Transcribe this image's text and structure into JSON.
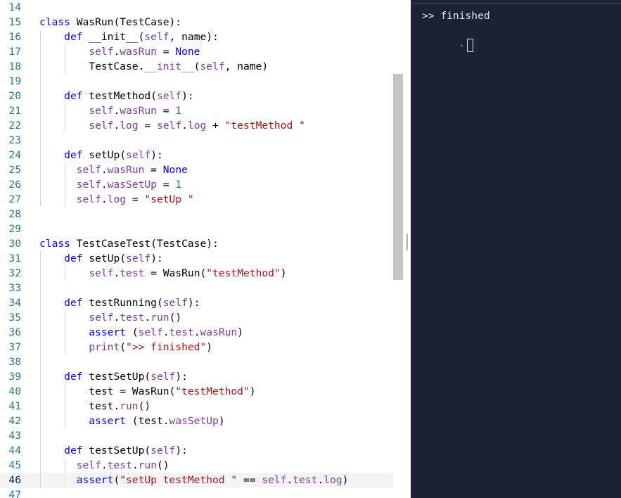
{
  "editor": {
    "current_line": 46,
    "lines": [
      {
        "no": "14",
        "segs": []
      },
      {
        "no": "15",
        "segs": [
          [
            "k",
            "class"
          ],
          [
            "p",
            " WasRun(TestCase):"
          ]
        ]
      },
      {
        "no": "16",
        "segs": [
          [
            "p",
            "    "
          ],
          [
            "k",
            "def"
          ],
          [
            "p",
            " __init__("
          ],
          [
            "sf",
            "self"
          ],
          [
            "p",
            ", name):"
          ]
        ]
      },
      {
        "no": "17",
        "segs": [
          [
            "p",
            "        "
          ],
          [
            "sf",
            "self"
          ],
          [
            "p",
            "."
          ],
          [
            "sf",
            "wasRun"
          ],
          [
            "p",
            " = "
          ],
          [
            "k",
            "None"
          ]
        ]
      },
      {
        "no": "18",
        "segs": [
          [
            "p",
            "        TestCase."
          ],
          [
            "sf",
            "__init__"
          ],
          [
            "p",
            "("
          ],
          [
            "sf",
            "self"
          ],
          [
            "p",
            ", name)"
          ]
        ]
      },
      {
        "no": "19",
        "segs": []
      },
      {
        "no": "20",
        "segs": [
          [
            "p",
            "    "
          ],
          [
            "k",
            "def"
          ],
          [
            "p",
            " testMethod("
          ],
          [
            "sf",
            "self"
          ],
          [
            "p",
            "):"
          ]
        ]
      },
      {
        "no": "21",
        "segs": [
          [
            "p",
            "        "
          ],
          [
            "sf",
            "self"
          ],
          [
            "p",
            "."
          ],
          [
            "sf",
            "wasRun"
          ],
          [
            "p",
            " = "
          ],
          [
            "n",
            "1"
          ]
        ]
      },
      {
        "no": "22",
        "segs": [
          [
            "p",
            "        "
          ],
          [
            "sf",
            "self"
          ],
          [
            "p",
            "."
          ],
          [
            "sf",
            "log"
          ],
          [
            "p",
            " = "
          ],
          [
            "sf",
            "self"
          ],
          [
            "p",
            "."
          ],
          [
            "sf",
            "log"
          ],
          [
            "p",
            " + "
          ],
          [
            "s",
            "\"testMethod \""
          ]
        ]
      },
      {
        "no": "23",
        "segs": []
      },
      {
        "no": "24",
        "segs": [
          [
            "p",
            "    "
          ],
          [
            "k",
            "def"
          ],
          [
            "p",
            " setUp("
          ],
          [
            "sf",
            "self"
          ],
          [
            "p",
            "):"
          ]
        ]
      },
      {
        "no": "25",
        "segs": [
          [
            "p",
            "      "
          ],
          [
            "sf",
            "self"
          ],
          [
            "p",
            "."
          ],
          [
            "sf",
            "wasRun"
          ],
          [
            "p",
            " = "
          ],
          [
            "k",
            "None"
          ]
        ]
      },
      {
        "no": "26",
        "segs": [
          [
            "p",
            "      "
          ],
          [
            "sf",
            "self"
          ],
          [
            "p",
            "."
          ],
          [
            "sf",
            "wasSetUp"
          ],
          [
            "p",
            " = "
          ],
          [
            "n",
            "1"
          ]
        ]
      },
      {
        "no": "27",
        "segs": [
          [
            "p",
            "      "
          ],
          [
            "sf",
            "self"
          ],
          [
            "p",
            "."
          ],
          [
            "sf",
            "log"
          ],
          [
            "p",
            " = "
          ],
          [
            "s",
            "\"setUp \""
          ]
        ]
      },
      {
        "no": "28",
        "segs": []
      },
      {
        "no": "29",
        "segs": []
      },
      {
        "no": "30",
        "segs": [
          [
            "k",
            "class"
          ],
          [
            "p",
            " TestCaseTest(TestCase):"
          ]
        ]
      },
      {
        "no": "31",
        "segs": [
          [
            "p",
            "    "
          ],
          [
            "k",
            "def"
          ],
          [
            "p",
            " setUp("
          ],
          [
            "sf",
            "self"
          ],
          [
            "p",
            "):"
          ]
        ]
      },
      {
        "no": "32",
        "segs": [
          [
            "p",
            "        "
          ],
          [
            "sf",
            "self"
          ],
          [
            "p",
            "."
          ],
          [
            "sf",
            "test"
          ],
          [
            "p",
            " = WasRun("
          ],
          [
            "s",
            "\"testMethod\""
          ],
          [
            "p",
            ")"
          ]
        ]
      },
      {
        "no": "33",
        "segs": []
      },
      {
        "no": "34",
        "segs": [
          [
            "p",
            "    "
          ],
          [
            "k",
            "def"
          ],
          [
            "p",
            " testRunning("
          ],
          [
            "sf",
            "self"
          ],
          [
            "p",
            "):"
          ]
        ]
      },
      {
        "no": "35",
        "segs": [
          [
            "p",
            "        "
          ],
          [
            "sf",
            "self"
          ],
          [
            "p",
            "."
          ],
          [
            "sf",
            "test"
          ],
          [
            "p",
            "."
          ],
          [
            "sf",
            "run"
          ],
          [
            "p",
            "()"
          ]
        ]
      },
      {
        "no": "36",
        "segs": [
          [
            "p",
            "        "
          ],
          [
            "k",
            "assert"
          ],
          [
            "p",
            " ("
          ],
          [
            "sf",
            "self"
          ],
          [
            "p",
            "."
          ],
          [
            "sf",
            "test"
          ],
          [
            "p",
            "."
          ],
          [
            "sf",
            "wasRun"
          ],
          [
            "p",
            ")"
          ]
        ]
      },
      {
        "no": "37",
        "segs": [
          [
            "p",
            "        "
          ],
          [
            "sf",
            "print"
          ],
          [
            "p",
            "("
          ],
          [
            "s",
            "\">> finished\""
          ],
          [
            "p",
            ")"
          ]
        ]
      },
      {
        "no": "38",
        "segs": []
      },
      {
        "no": "39",
        "segs": [
          [
            "p",
            "    "
          ],
          [
            "k",
            "def"
          ],
          [
            "p",
            " testSetUp("
          ],
          [
            "sf",
            "self"
          ],
          [
            "p",
            "):"
          ]
        ]
      },
      {
        "no": "40",
        "segs": [
          [
            "p",
            "        test = WasRun("
          ],
          [
            "s",
            "\"testMethod\""
          ],
          [
            "p",
            ")"
          ]
        ]
      },
      {
        "no": "41",
        "segs": [
          [
            "p",
            "        test."
          ],
          [
            "sf",
            "run"
          ],
          [
            "p",
            "()"
          ]
        ]
      },
      {
        "no": "42",
        "segs": [
          [
            "p",
            "        "
          ],
          [
            "k",
            "assert"
          ],
          [
            "p",
            " (test."
          ],
          [
            "sf",
            "wasSetUp"
          ],
          [
            "p",
            ")"
          ]
        ]
      },
      {
        "no": "43",
        "segs": []
      },
      {
        "no": "44",
        "segs": [
          [
            "p",
            "    "
          ],
          [
            "k",
            "def"
          ],
          [
            "p",
            " testSetUp("
          ],
          [
            "sf",
            "self"
          ],
          [
            "p",
            "):"
          ]
        ]
      },
      {
        "no": "45",
        "segs": [
          [
            "p",
            "      "
          ],
          [
            "sf",
            "self"
          ],
          [
            "p",
            "."
          ],
          [
            "sf",
            "test"
          ],
          [
            "p",
            "."
          ],
          [
            "sf",
            "run"
          ],
          [
            "p",
            "()"
          ]
        ]
      },
      {
        "no": "46",
        "segs": [
          [
            "p",
            "      "
          ],
          [
            "k",
            "assert"
          ],
          [
            "p",
            "("
          ],
          [
            "s",
            "\"setUp testMethod \""
          ],
          [
            "p",
            " == "
          ],
          [
            "sf",
            "self"
          ],
          [
            "p",
            "."
          ],
          [
            "sf",
            "test"
          ],
          [
            "p",
            "."
          ],
          [
            "sf",
            "log"
          ],
          [
            "p",
            ")"
          ]
        ]
      },
      {
        "no": "47",
        "segs": []
      }
    ]
  },
  "terminal": {
    "output_line": ">> finished",
    "prompt_symbol": "›",
    "prompt_color": "#e8853a",
    "background": "#1a2233"
  }
}
